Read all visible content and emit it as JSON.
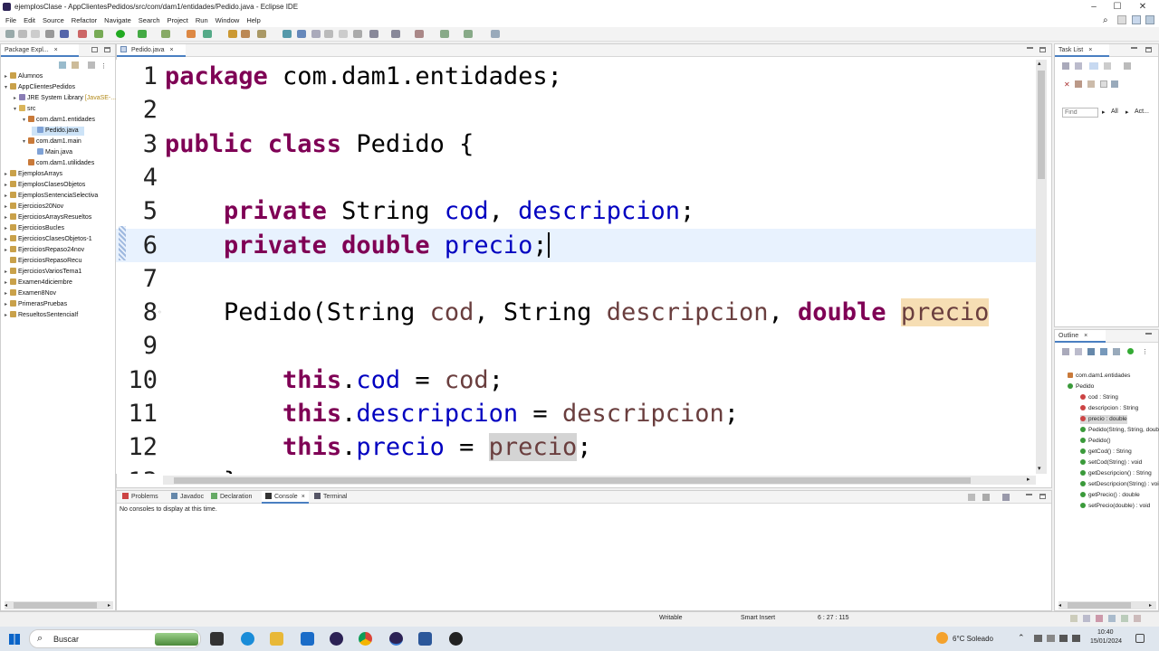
{
  "window": {
    "title": "ejemplosClase - AppClientesPedidos/src/com/dam1/entidades/Pedido.java - Eclipse IDE",
    "controls": {
      "minimize": "–",
      "maximize": "☐",
      "close": "✕"
    }
  },
  "menu": [
    "File",
    "Edit",
    "Source",
    "Refactor",
    "Navigate",
    "Search",
    "Project",
    "Run",
    "Window",
    "Help"
  ],
  "package_explorer": {
    "tab_label": "Package Expl...",
    "items": [
      {
        "label": "Alumnos",
        "type": "project",
        "expander": "▸"
      },
      {
        "label": "AppClientesPedidos",
        "type": "project",
        "expander": "▾"
      },
      {
        "label": "JRE System Library",
        "suffix": "[JavaSE-...]",
        "type": "library",
        "expander": "▸"
      },
      {
        "label": "src",
        "type": "folder",
        "expander": "▾"
      },
      {
        "label": "com.dam1.entidades",
        "type": "package",
        "expander": "▾"
      },
      {
        "label": "Pedido.java",
        "type": "java",
        "expander": "",
        "selected": true
      },
      {
        "label": "com.dam1.main",
        "type": "package",
        "expander": "▾"
      },
      {
        "label": "Main.java",
        "type": "java",
        "expander": ""
      },
      {
        "label": "com.dam1.utilidades",
        "type": "package",
        "expander": ""
      },
      {
        "label": "EjemplosArrays",
        "type": "project",
        "expander": "▸"
      },
      {
        "label": "EjemplosClasesObjetos",
        "type": "project",
        "expander": "▸"
      },
      {
        "label": "EjemplosSentenciaSelectiva",
        "type": "project",
        "expander": "▸"
      },
      {
        "label": "Ejercicios20Nov",
        "type": "project",
        "expander": "▸"
      },
      {
        "label": "EjerciciosArraysResueltos",
        "type": "project",
        "expander": "▸"
      },
      {
        "label": "EjerciciosBucles",
        "type": "project",
        "expander": "▸"
      },
      {
        "label": "EjerciciosClasesObjetos-1",
        "type": "project",
        "expander": "▸"
      },
      {
        "label": "EjerciciosRepaso24nov",
        "type": "project",
        "expander": "▸"
      },
      {
        "label": "EjerciciosRepasoRecu",
        "type": "project",
        "expander": ""
      },
      {
        "label": "EjerciciosVariosTema1",
        "type": "project",
        "expander": "▸"
      },
      {
        "label": "Examen4diciembre",
        "type": "project",
        "expander": "▸"
      },
      {
        "label": "Examen8Nov",
        "type": "project",
        "expander": "▸"
      },
      {
        "label": "PrimerasPruebas",
        "type": "project",
        "expander": "▸"
      },
      {
        "label": "ResueltosSentenciaIf",
        "type": "project",
        "expander": "▸"
      }
    ]
  },
  "editor": {
    "tab_label": "Pedido.java",
    "lines": [
      {
        "n": "1",
        "segs": [
          {
            "t": "package",
            "c": "kw"
          },
          {
            "t": " com.dam1.entidades;",
            "c": ""
          }
        ]
      },
      {
        "n": "2",
        "segs": []
      },
      {
        "n": "3",
        "segs": [
          {
            "t": "public class",
            "c": "kw"
          },
          {
            "t": " Pedido {",
            "c": ""
          }
        ]
      },
      {
        "n": "4",
        "segs": []
      },
      {
        "n": "5",
        "segs": [
          {
            "t": "    ",
            "c": ""
          },
          {
            "t": "private",
            "c": "kw"
          },
          {
            "t": " String ",
            "c": ""
          },
          {
            "t": "cod",
            "c": "fld"
          },
          {
            "t": ", ",
            "c": ""
          },
          {
            "t": "descripcion",
            "c": "fld"
          },
          {
            "t": ";",
            "c": ""
          }
        ]
      },
      {
        "n": "6",
        "segs": [
          {
            "t": "    ",
            "c": ""
          },
          {
            "t": "private double",
            "c": "kw"
          },
          {
            "t": " ",
            "c": ""
          },
          {
            "t": "precio",
            "c": "fld"
          },
          {
            "t": ";",
            "c": ""
          },
          {
            "t": "",
            "c": "caret"
          }
        ],
        "current": true
      },
      {
        "n": "7",
        "segs": []
      },
      {
        "n": "8",
        "segs": [
          {
            "t": "    Pedido(String ",
            "c": ""
          },
          {
            "t": "cod",
            "c": "prm"
          },
          {
            "t": ", String ",
            "c": ""
          },
          {
            "t": "descripcion",
            "c": "prm"
          },
          {
            "t": ", ",
            "c": ""
          },
          {
            "t": "double",
            "c": "kw"
          },
          {
            "t": " ",
            "c": ""
          },
          {
            "t": "precio",
            "c": "prm hl"
          }
        ]
      },
      {
        "n": "9",
        "segs": []
      },
      {
        "n": "10",
        "segs": [
          {
            "t": "        ",
            "c": ""
          },
          {
            "t": "this",
            "c": "kw"
          },
          {
            "t": ".",
            "c": ""
          },
          {
            "t": "cod",
            "c": "fld"
          },
          {
            "t": " = ",
            "c": ""
          },
          {
            "t": "cod",
            "c": "prm"
          },
          {
            "t": ";",
            "c": ""
          }
        ]
      },
      {
        "n": "11",
        "segs": [
          {
            "t": "        ",
            "c": ""
          },
          {
            "t": "this",
            "c": "kw"
          },
          {
            "t": ".",
            "c": ""
          },
          {
            "t": "descripcion",
            "c": "fld"
          },
          {
            "t": " = ",
            "c": ""
          },
          {
            "t": "descripcion",
            "c": "prm"
          },
          {
            "t": ";",
            "c": ""
          }
        ]
      },
      {
        "n": "12",
        "segs": [
          {
            "t": "        ",
            "c": ""
          },
          {
            "t": "this",
            "c": "kw"
          },
          {
            "t": ".",
            "c": ""
          },
          {
            "t": "precio",
            "c": "fld"
          },
          {
            "t": " = ",
            "c": ""
          },
          {
            "t": "precio",
            "c": "prm occ"
          },
          {
            "t": ";",
            "c": ""
          }
        ]
      },
      {
        "n": "13",
        "segs": [
          {
            "t": "    }",
            "c": ""
          }
        ]
      }
    ]
  },
  "bottom_panel": {
    "tabs": [
      "Problems",
      "Javadoc",
      "Declaration",
      "Console",
      "Terminal"
    ],
    "active_tab": "Console",
    "message": "No consoles to display at this time."
  },
  "task_list": {
    "tab_label": "Task List",
    "find_placeholder": "Find",
    "all_label": "All",
    "act_label": "Act..."
  },
  "outline": {
    "tab_label": "Outline",
    "items": [
      {
        "label": "com.dam1.entidades",
        "kind": "package"
      },
      {
        "label": "Pedido",
        "kind": "class"
      },
      {
        "label": "cod : String",
        "kind": "field"
      },
      {
        "label": "descripcion : String",
        "kind": "field"
      },
      {
        "label": "precio : double",
        "kind": "field",
        "selected": true
      },
      {
        "label": "Pedido(String, String, double)",
        "kind": "ctor"
      },
      {
        "label": "Pedido()",
        "kind": "ctor"
      },
      {
        "label": "getCod() : String",
        "kind": "method"
      },
      {
        "label": "setCod(String) : void",
        "kind": "method"
      },
      {
        "label": "getDescripcion() : String",
        "kind": "method"
      },
      {
        "label": "setDescripcion(String) : void",
        "kind": "method"
      },
      {
        "label": "getPrecio() : double",
        "kind": "method"
      },
      {
        "label": "setPrecio(double) : void",
        "kind": "method"
      }
    ]
  },
  "status": {
    "writable": "Writable",
    "insert_mode": "Smart Insert",
    "position": "6 : 27 : 115"
  },
  "taskbar": {
    "search_label": "Buscar",
    "weather": "6°C Soleado",
    "time": "10:40",
    "date": "15/01/2024"
  },
  "colors": {
    "keyword": "#7f0055",
    "field": "#0000c0",
    "param": "#6a3e3e",
    "current_line": "#e8f2fe",
    "accent": "#4a7fc1"
  }
}
